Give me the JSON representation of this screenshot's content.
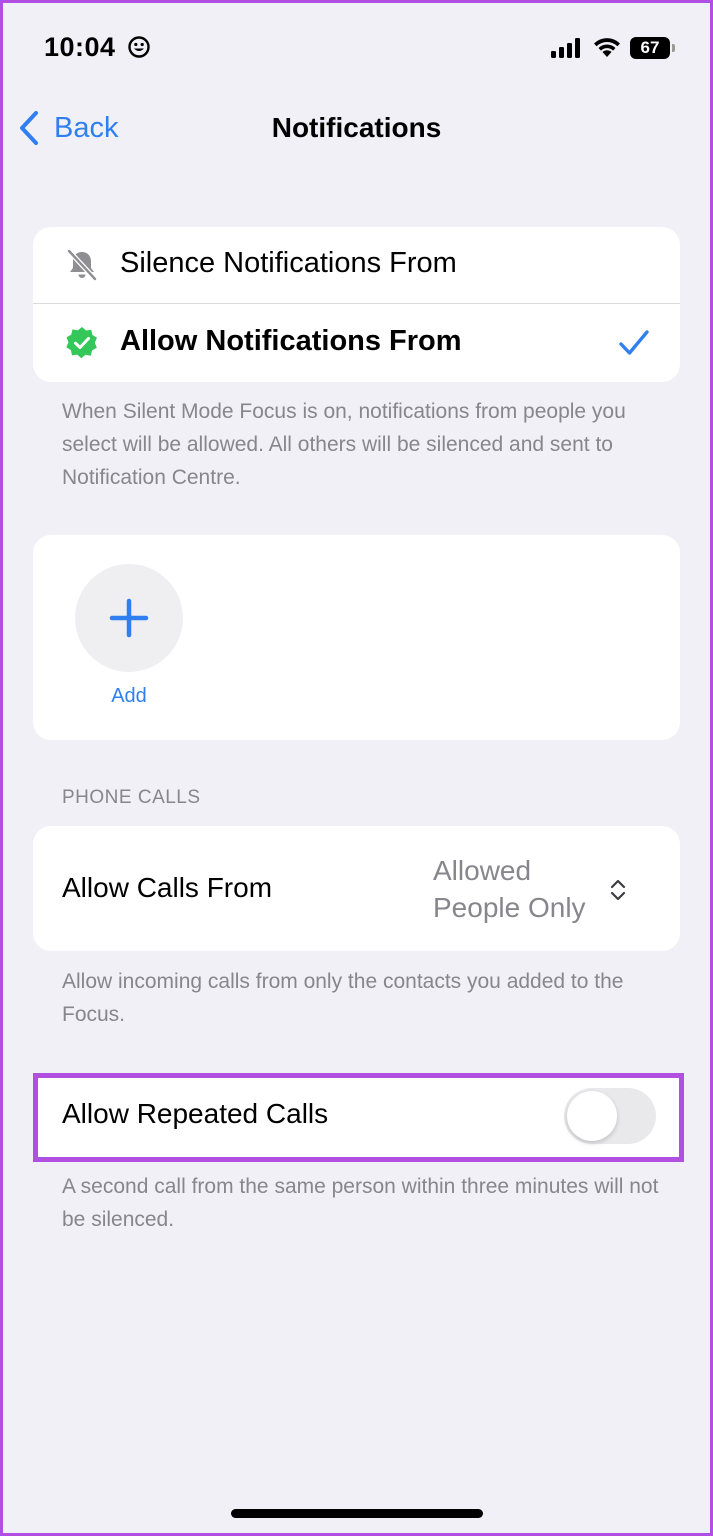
{
  "status_bar": {
    "time": "10:04",
    "battery_level": "67"
  },
  "nav": {
    "back_label": "Back",
    "title": "Notifications"
  },
  "notification_mode": {
    "options": [
      {
        "label": "Silence Notifications From",
        "icon": "bell-slash-icon",
        "selected": false
      },
      {
        "label": "Allow Notifications From",
        "icon": "green-check-badge-icon",
        "selected": true
      }
    ],
    "footnote": "When Silent Mode  Focus is on, notifications from people you select will be allowed. All others will be silenced and sent to Notification Centre."
  },
  "people": {
    "add_label": "Add"
  },
  "phone_calls": {
    "section_header": "PHONE CALLS",
    "allow_calls_label": "Allow Calls From",
    "allow_calls_value_line1": "Allowed",
    "allow_calls_value_line2": "People Only",
    "allow_calls_footnote": "Allow incoming calls from only the contacts you added to the Focus.",
    "repeated_calls_label": "Allow Repeated Calls",
    "repeated_calls_enabled": false,
    "repeated_calls_footnote": "A second call from the same person within three minutes will not be silenced."
  },
  "colors": {
    "accent": "#2f7ff0",
    "highlight": "#b04fe0",
    "badge_green": "#34c759",
    "secondary_text": "#86868c",
    "background": "#f1f0f6"
  }
}
